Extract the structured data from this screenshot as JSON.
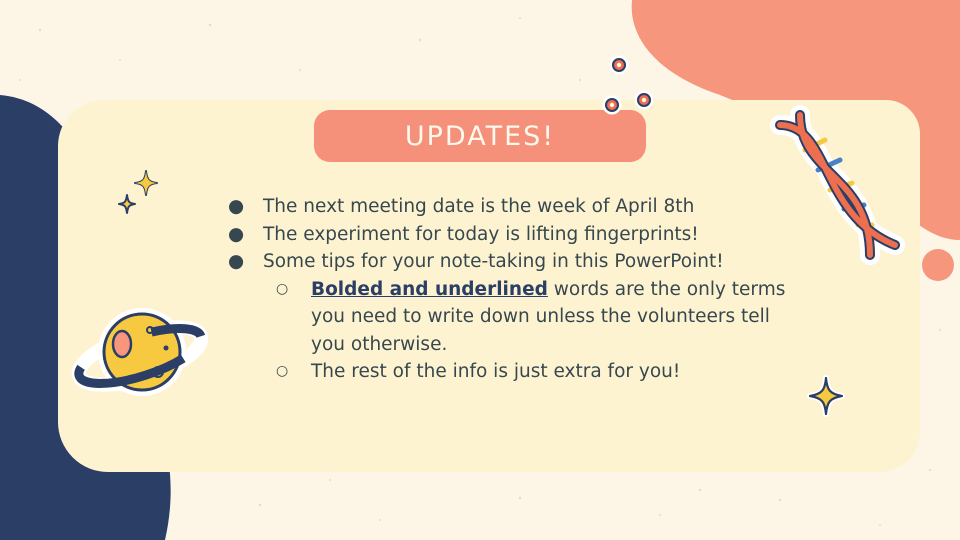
{
  "slide": {
    "title": "UPDATES!",
    "bullets": [
      {
        "text": "The next meeting date is the week of April 8th"
      },
      {
        "text": "The experiment for today is lifting fingerprints!"
      },
      {
        "text": "Some tips for your note-taking in this PowerPoint!"
      }
    ],
    "sub_bullets": [
      {
        "emphasis": "Bolded and underlined",
        "text": " words are the only terms you need to write down unless the volunteers tell you otherwise."
      },
      {
        "text": "The rest of the info is just extra for you!"
      }
    ]
  },
  "colors": {
    "background": "#fdf6e7",
    "card": "#fef3d0",
    "title_pill": "#f5907a",
    "navy_blob": "#2a3e66",
    "coral_blob": "#f6967c",
    "text": "#37474f"
  },
  "stickers": [
    "sparkle-icon",
    "planet-icon",
    "dna-icon",
    "circles-icon"
  ]
}
